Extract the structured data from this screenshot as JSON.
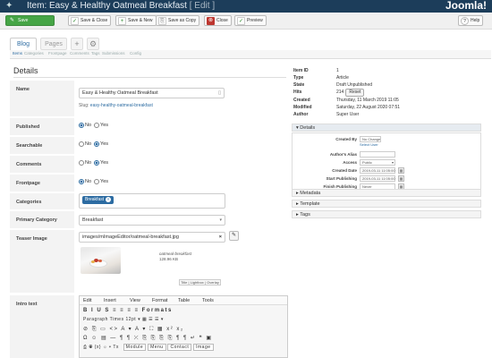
{
  "header": {
    "title": "Item: Easy & Healthy Oatmeal Breakfast",
    "edit": "[ Edit ]",
    "logo": "Joomla!"
  },
  "toolbar": {
    "save": "Save",
    "save_close": "Save & Close",
    "save_new": "Save & New",
    "save_copy": "Save as Copy",
    "close": "Close",
    "preview": "Preview",
    "help": "Help"
  },
  "tabs": {
    "blog": "Blog",
    "pages": "Pages"
  },
  "subnav": [
    "Items",
    "Categories",
    "Frontpage",
    "Comments",
    "Tags",
    "Submissions",
    "Config"
  ],
  "details_title": "Details",
  "fields": {
    "name_label": "Name",
    "name_value": "Easy & Healthy Oatmeal Breakfast",
    "slug_prefix": "Slug:",
    "slug_value": "easy-healthy-oatmeal-breakfast",
    "published_label": "Published",
    "searchable_label": "Searchable",
    "comments_label": "Comments",
    "frontpage_label": "Frontpage",
    "no": "No",
    "yes": "Yes",
    "categories_label": "Categories",
    "category_chip": "Breakfast",
    "primary_label": "Primary Category",
    "primary_value": "Breakfast",
    "teaser_label": "Teaser Image",
    "teaser_path": "images/mImageEditor/oatmeal-breakfast.jpg",
    "teaser_name": "oatmeal-breakfast",
    "teaser_size": "128.96 KB",
    "title_btn": "Title",
    "lightbox_btn": "Lightbox",
    "overlay_btn": "Overlay",
    "intro_label": "Intro text"
  },
  "radio_state": {
    "published": "no",
    "searchable": "yes",
    "comments": "yes",
    "frontpage": "no"
  },
  "editor": {
    "menu": [
      "Edit",
      "Insert",
      "View",
      "Format",
      "Table",
      "Tools"
    ],
    "row1": "B I U S  ≡ ≡ ≡ ≡   Formats",
    "row2": "Paragraph  Times  12pt  ▾ ▦ ☰ ☰ ▾",
    "row3": "⊘ ⎘ ▭ <> A ▾ A ▾ ⛶ ▦ x² x₂",
    "row4": "Ω ☺ ▤ — ¶ ¶ ⤫ ⎘ ⎘ ⎘ ⎘ ¶ ¶ ↵ ❝ ▣",
    "row5": "⎙ ◉ {x} ☼ ▾ Tx",
    "plugins": [
      "Module",
      "Menu",
      "Contact",
      "Image"
    ]
  },
  "meta": {
    "item_id_k": "Item ID",
    "item_id_v": "1",
    "type_k": "Type",
    "type_v": "Article",
    "state_k": "State",
    "state_v": "Draft Unpublished",
    "hits_k": "Hits",
    "hits_v": "214",
    "reset": "Reset",
    "created_k": "Created",
    "created_v": "Thursday, 11 March 2019 11:05",
    "modified_k": "Modified",
    "modified_v": "Saturday, 22 August 2020 07:51",
    "author_k": "Author",
    "author_v": "Super User"
  },
  "accordion": {
    "details": "Details",
    "metadata": "Metadata",
    "template": "Template",
    "tags": "Tags"
  },
  "details_panel": {
    "created_by_k": "Created By",
    "created_by_v": "No Change",
    "select_user": "Select User",
    "authors_alias_k": "Author's Alias",
    "access_k": "Access",
    "access_v": "Public",
    "created_date_k": "Created Date",
    "created_date_v": "2019-03-11 11:05:00",
    "start_pub_k": "Start Publishing",
    "start_pub_v": "2019-03-11 11:05:00",
    "finish_pub_k": "Finish Publishing",
    "finish_pub_v": "Never"
  }
}
